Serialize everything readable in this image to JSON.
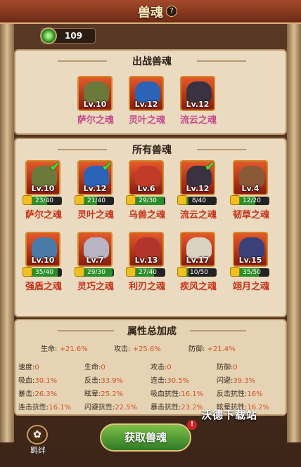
{
  "header": {
    "title": "兽魂",
    "help": "?"
  },
  "currency": {
    "value": "109"
  },
  "deployed": {
    "title": "出战兽魂",
    "items": [
      {
        "name": "萨尔之魂",
        "level": "Lv.10",
        "color": "#6b7a3a"
      },
      {
        "name": "灵叶之魂",
        "level": "Lv.12",
        "color": "#2b63b6"
      },
      {
        "name": "流云之魂",
        "level": "Lv.12",
        "color": "#3a3240"
      }
    ]
  },
  "all": {
    "title": "所有兽魂",
    "rows": [
      [
        {
          "name": "萨尔之魂",
          "level": "Lv.10",
          "progress": "23/40",
          "fill": 0.575,
          "checked": true,
          "color": "#6b7a3a"
        },
        {
          "name": "灵叶之魂",
          "level": "Lv.12",
          "progress": "21/40",
          "fill": 0.525,
          "checked": true,
          "color": "#2b63b6"
        },
        {
          "name": "乌兽之魂",
          "level": "Lv.6",
          "progress": "29/30",
          "fill": 0.967,
          "checked": false,
          "color": "#c23a28"
        },
        {
          "name": "流云之魂",
          "level": "Lv.12",
          "progress": "8/40",
          "fill": 0.2,
          "checked": true,
          "color": "#3a3240"
        },
        {
          "name": "韧草之魂",
          "level": "Lv.4",
          "progress": "12/20",
          "fill": 0.6,
          "checked": false,
          "color": "#8a5a36"
        }
      ],
      [
        {
          "name": "强盾之魂",
          "level": "Lv.10",
          "progress": "35/40",
          "fill": 0.875,
          "checked": false,
          "color": "#4a7ba8"
        },
        {
          "name": "灵巧之魂",
          "level": "Lv.7",
          "progress": "29/30",
          "fill": 0.967,
          "checked": false,
          "color": "#b9b4c4"
        },
        {
          "name": "利刃之魂",
          "level": "Lv.13",
          "progress": "27/40",
          "fill": 0.675,
          "checked": false,
          "color": "#b2342a"
        },
        {
          "name": "疾风之魂",
          "level": "Lv.17",
          "progress": "10/50",
          "fill": 0.2,
          "checked": false,
          "color": "#d8d2c2"
        },
        {
          "name": "翊月之魂",
          "level": "Lv.15",
          "progress": "35/50",
          "fill": 0.7,
          "checked": false,
          "color": "#39407a"
        }
      ]
    ]
  },
  "stats": {
    "title": "属性总加成",
    "top": [
      {
        "label": "生命:",
        "value": "+21.6%"
      },
      {
        "label": "攻击:",
        "value": "+25.6%"
      },
      {
        "label": "防御:",
        "value": "+21.4%"
      }
    ],
    "grid": [
      [
        {
          "label": "速度:",
          "value": "0"
        },
        {
          "label": "生命:",
          "value": "0"
        },
        {
          "label": "攻击:",
          "value": "0"
        },
        {
          "label": "防御:",
          "value": "0"
        }
      ],
      [
        {
          "label": "吸血:",
          "value": "30.1%"
        },
        {
          "label": "反击:",
          "value": "33.9%"
        },
        {
          "label": "连击:",
          "value": "30.5%"
        },
        {
          "label": "闪避:",
          "value": "39.3%"
        }
      ],
      [
        {
          "label": "暴击:",
          "value": "26.3%"
        },
        {
          "label": "眩晕:",
          "value": "25.2%"
        },
        {
          "label": "吸血抗性:",
          "value": "16.1%"
        },
        {
          "label": "反击抗性:",
          "value": "16%"
        }
      ],
      [
        {
          "label": "连击抗性:",
          "value": "16.1%"
        },
        {
          "label": "闪避抗性:",
          "value": "22.5%"
        },
        {
          "label": "暴击抗性:",
          "value": "23.2%"
        },
        {
          "label": "眩晕抗性:",
          "value": "16.2%"
        }
      ]
    ]
  },
  "footer": {
    "get_button": "获取兽魂",
    "alert": "!",
    "bond_label": "羁绊",
    "bond_icon": "bond-icon",
    "watermark": "沃德下载站"
  }
}
